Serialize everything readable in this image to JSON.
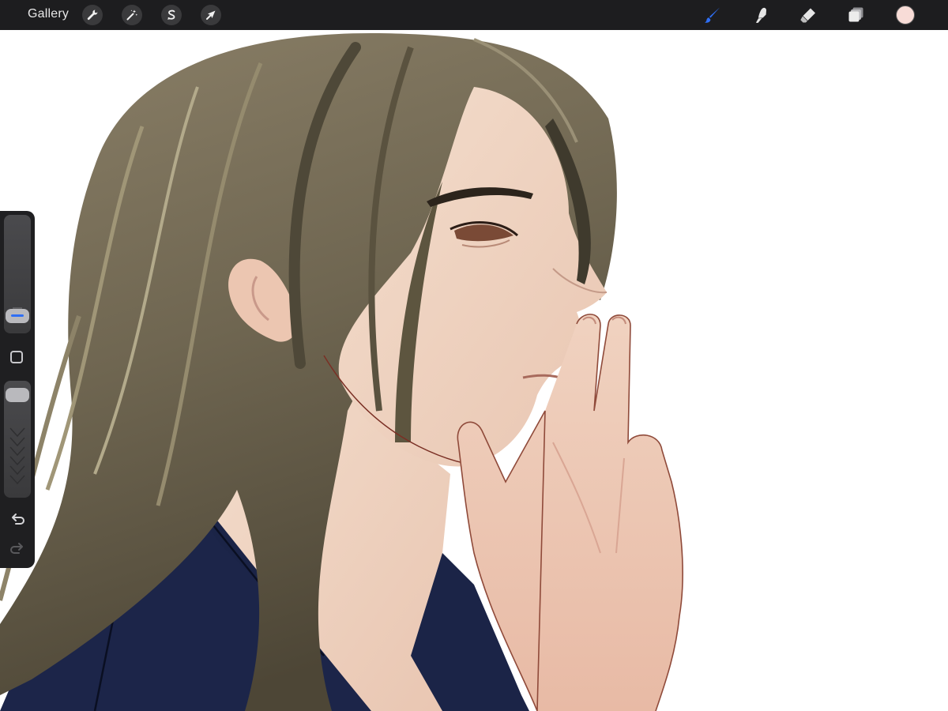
{
  "toolbar": {
    "gallery_label": "Gallery",
    "left_tools": [
      {
        "name": "actions",
        "icon": "wrench-icon"
      },
      {
        "name": "adjustments",
        "icon": "magic-wand-icon"
      },
      {
        "name": "selection",
        "icon": "selection-s-icon"
      },
      {
        "name": "transform",
        "icon": "arrow-cursor-icon"
      }
    ],
    "right_tools": [
      {
        "name": "brush",
        "icon": "brush-icon",
        "active": true
      },
      {
        "name": "smudge",
        "icon": "smudge-icon"
      },
      {
        "name": "eraser",
        "icon": "eraser-icon"
      },
      {
        "name": "layers",
        "icon": "layers-icon"
      }
    ],
    "current_color": "#f8dcd7",
    "active_color": "#2f6ff5"
  },
  "sidebar": {
    "brush_size_level": 0.08,
    "opacity_level": 0.95
  }
}
